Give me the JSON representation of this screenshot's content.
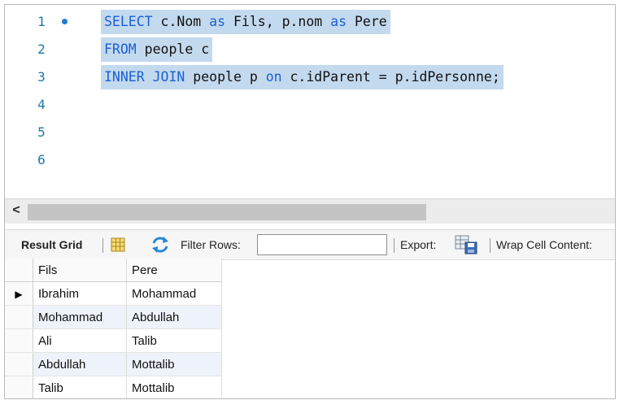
{
  "editor": {
    "lines": [
      {
        "num": "1",
        "tokens": [
          {
            "t": "SELECT",
            "kw": true
          },
          {
            "t": " c.Nom ",
            "kw": false
          },
          {
            "t": "as",
            "kw": true
          },
          {
            "t": " Fils, p.nom ",
            "kw": false
          },
          {
            "t": "as",
            "kw": true
          },
          {
            "t": " Pere",
            "kw": false
          }
        ]
      },
      {
        "num": "2",
        "tokens": [
          {
            "t": "FROM",
            "kw": true
          },
          {
            "t": " people c",
            "kw": false
          }
        ]
      },
      {
        "num": "3",
        "tokens": [
          {
            "t": "INNER JOIN",
            "kw": true
          },
          {
            "t": " people p ",
            "kw": false
          },
          {
            "t": "on",
            "kw": true
          },
          {
            "t": " c.idParent = p.idPersonne;",
            "kw": false
          }
        ]
      },
      {
        "num": "4",
        "tokens": []
      },
      {
        "num": "5",
        "tokens": []
      },
      {
        "num": "6",
        "tokens": []
      }
    ],
    "scroll_left_glyph": "<"
  },
  "toolbar": {
    "result_grid_label": "Result Grid",
    "filter_rows_label": "Filter Rows:",
    "filter_value": "",
    "export_label": "Export:",
    "wrap_label": "Wrap Cell Content:"
  },
  "grid": {
    "columns": [
      "Fils",
      "Pere"
    ],
    "rows": [
      [
        "Ibrahim",
        "Mohammad"
      ],
      [
        "Mohammad",
        "Abdullah"
      ],
      [
        "Ali",
        "Talib"
      ],
      [
        "Abdullah",
        "Mottalib"
      ],
      [
        "Talib",
        "Mottalib"
      ]
    ],
    "current_row_marker": "▶"
  },
  "colors": {
    "keyword": "#1a5fd4",
    "selection": "#c3d9ee",
    "line_number": "#1e78a8"
  }
}
